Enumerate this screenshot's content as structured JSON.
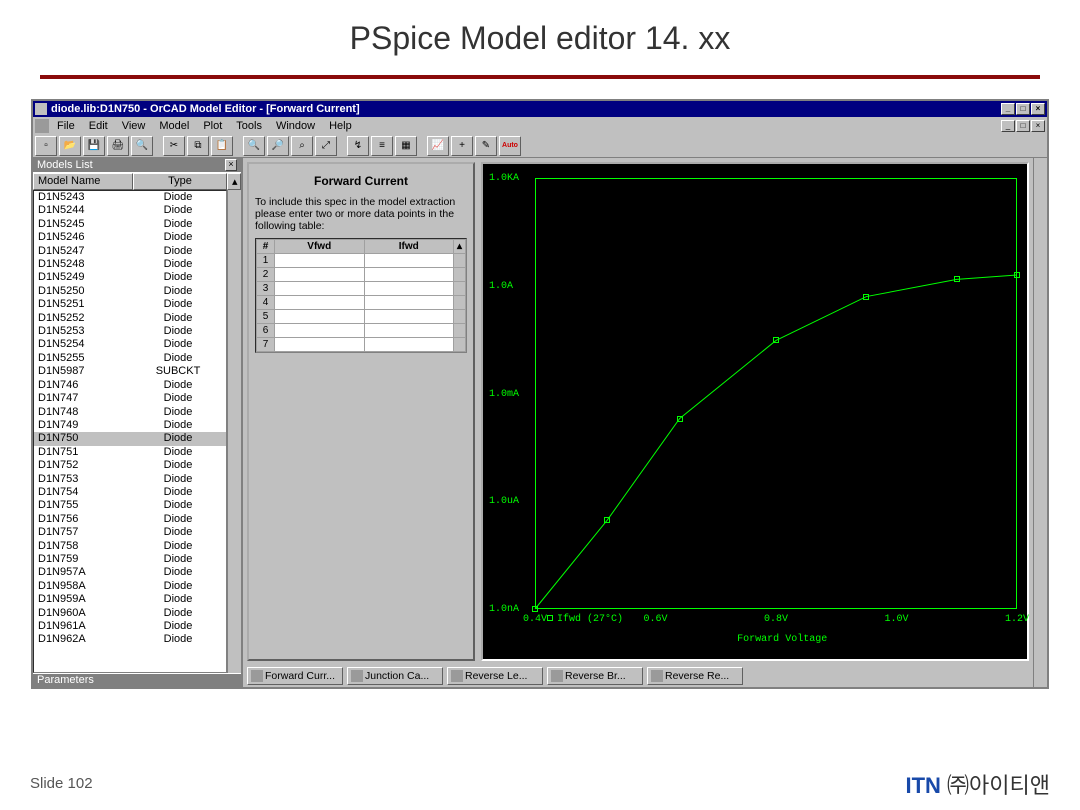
{
  "slide": {
    "title": "PSpice Model editor 14. xx",
    "footer_left": "Slide 102",
    "footer_right_brand": "ITN",
    "footer_right_rest": " ㈜아이티앤"
  },
  "app": {
    "title": "diode.lib:D1N750 - OrCAD Model Editor - [Forward Current]",
    "menus": [
      "File",
      "Edit",
      "View",
      "Model",
      "Plot",
      "Tools",
      "Window",
      "Help"
    ],
    "models_panel_title": "Models List",
    "col_name": "Model Name",
    "col_type": "Type",
    "params_title": "Parameters",
    "selected_model": "D1N750",
    "models": [
      {
        "n": "D1N5243",
        "t": "Diode"
      },
      {
        "n": "D1N5244",
        "t": "Diode"
      },
      {
        "n": "D1N5245",
        "t": "Diode"
      },
      {
        "n": "D1N5246",
        "t": "Diode"
      },
      {
        "n": "D1N5247",
        "t": "Diode"
      },
      {
        "n": "D1N5248",
        "t": "Diode"
      },
      {
        "n": "D1N5249",
        "t": "Diode"
      },
      {
        "n": "D1N5250",
        "t": "Diode"
      },
      {
        "n": "D1N5251",
        "t": "Diode"
      },
      {
        "n": "D1N5252",
        "t": "Diode"
      },
      {
        "n": "D1N5253",
        "t": "Diode"
      },
      {
        "n": "D1N5254",
        "t": "Diode"
      },
      {
        "n": "D1N5255",
        "t": "Diode"
      },
      {
        "n": "D1N5987",
        "t": "SUBCKT"
      },
      {
        "n": "D1N746",
        "t": "Diode"
      },
      {
        "n": "D1N747",
        "t": "Diode"
      },
      {
        "n": "D1N748",
        "t": "Diode"
      },
      {
        "n": "D1N749",
        "t": "Diode"
      },
      {
        "n": "D1N750",
        "t": "Diode"
      },
      {
        "n": "D1N751",
        "t": "Diode"
      },
      {
        "n": "D1N752",
        "t": "Diode"
      },
      {
        "n": "D1N753",
        "t": "Diode"
      },
      {
        "n": "D1N754",
        "t": "Diode"
      },
      {
        "n": "D1N755",
        "t": "Diode"
      },
      {
        "n": "D1N756",
        "t": "Diode"
      },
      {
        "n": "D1N757",
        "t": "Diode"
      },
      {
        "n": "D1N758",
        "t": "Diode"
      },
      {
        "n": "D1N759",
        "t": "Diode"
      },
      {
        "n": "D1N957A",
        "t": "Diode"
      },
      {
        "n": "D1N958A",
        "t": "Diode"
      },
      {
        "n": "D1N959A",
        "t": "Diode"
      },
      {
        "n": "D1N960A",
        "t": "Diode"
      },
      {
        "n": "D1N961A",
        "t": "Diode"
      },
      {
        "n": "D1N962A",
        "t": "Diode"
      }
    ]
  },
  "spec": {
    "heading": "Forward Current",
    "text": "To include this spec in the model extraction please enter two or more data points in the following table:",
    "cols": {
      "idx": "#",
      "v": "Vfwd",
      "i": "Ifwd"
    },
    "rows": [
      "1",
      "2",
      "3",
      "4",
      "5",
      "6",
      "7"
    ]
  },
  "plot": {
    "yticks": [
      "1.0KA",
      "1.0A",
      "1.0mA",
      "1.0uA",
      "1.0nA"
    ],
    "xticks": [
      "0.4V",
      "0.6V",
      "0.8V",
      "1.0V",
      "1.2V"
    ],
    "xlabel": "Forward Voltage",
    "series_label": "Ifwd (27°C)"
  },
  "chart_data": {
    "type": "line",
    "title": "Forward Current",
    "xlabel": "Forward Voltage",
    "ylabel": "Ifwd",
    "x_units": "V",
    "y_units": "A",
    "y_scale": "log",
    "xlim": [
      0.4,
      1.2
    ],
    "ylim": [
      1e-09,
      1000
    ],
    "series": [
      {
        "name": "Ifwd (27°C)",
        "x": [
          0.4,
          0.52,
          0.64,
          0.8,
          0.95,
          1.1,
          1.2
        ],
        "y": [
          1e-09,
          3e-07,
          0.0002,
          0.03,
          0.5,
          1.5,
          2.0
        ]
      }
    ]
  },
  "tabs": [
    "Forward Curr...",
    "Junction Ca...",
    "Reverse Le...",
    "Reverse Br...",
    "Reverse Re..."
  ]
}
